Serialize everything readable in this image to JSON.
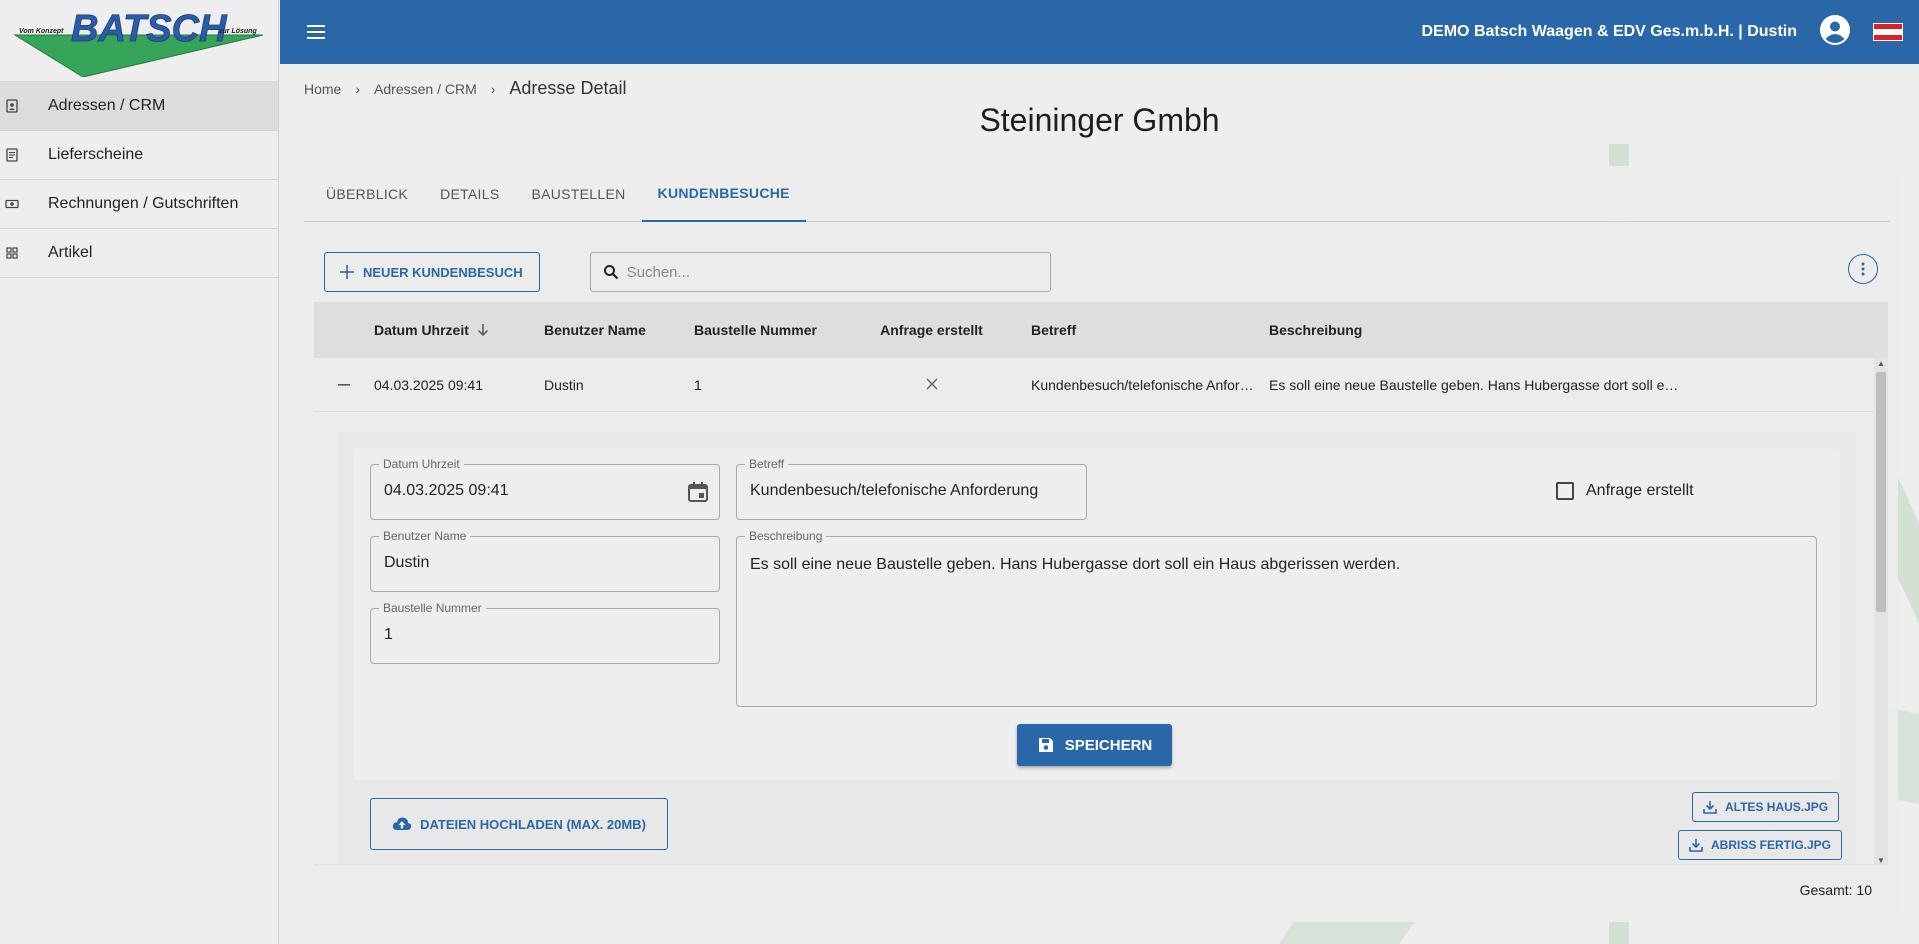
{
  "sidebar": {
    "logo": {
      "name": "BATSCH",
      "left_tag": "Vom Konzept",
      "right_tag": "zur Lösung"
    },
    "items": [
      {
        "label": "Adressen / CRM",
        "icon": "address-book-icon",
        "active": true
      },
      {
        "label": "Lieferscheine",
        "icon": "document-icon",
        "active": false
      },
      {
        "label": "Rechnungen / Gutschriften",
        "icon": "money-icon",
        "active": false
      },
      {
        "label": "Artikel",
        "icon": "grid-icon",
        "active": false
      }
    ]
  },
  "topbar": {
    "company": "DEMO Batsch Waagen & EDV Ges.m.b.H. | Dustin",
    "color": "#2a67a8"
  },
  "breadcrumb": {
    "home": "Home",
    "section": "Adressen / CRM",
    "current": "Adresse Detail"
  },
  "page_title": "Steininger Gmbh",
  "tabs": [
    {
      "label": "ÜBERBLICK",
      "active": false
    },
    {
      "label": "DETAILS",
      "active": false
    },
    {
      "label": "BAUSTELLEN",
      "active": false
    },
    {
      "label": "KUNDENBESUCHE",
      "active": true
    }
  ],
  "toolbar": {
    "new_label": "NEUER KUNDENBESUCH",
    "search_placeholder": "Suchen..."
  },
  "table": {
    "columns": [
      "Datum Uhrzeit",
      "Benutzer Name",
      "Baustelle Nummer",
      "Anfrage erstellt",
      "Betreff",
      "Beschreibung"
    ],
    "rows": [
      {
        "datum": "04.03.2025 09:41",
        "benutzer": "Dustin",
        "baustelle": "1",
        "anfrage": false,
        "betreff": "Kundenbesuch/telefonische Anforderung",
        "beschreibung": "Es soll eine neue Baustelle geben. Hans Hubergasse dort soll ein Haus abgerissen werden."
      }
    ]
  },
  "detail": {
    "datum_label": "Datum Uhrzeit",
    "datum_value": "04.03.2025 09:41",
    "betreff_label": "Betreff",
    "betreff_value": "Kundenbesuch/telefonische Anforderung",
    "anfrage_label": "Anfrage erstellt",
    "benutzer_label": "Benutzer Name",
    "benutzer_value": "Dustin",
    "baustelle_label": "Baustelle Nummer",
    "baustelle_value": "1",
    "beschreibung_label": "Beschreibung",
    "beschreibung_value": "Es soll eine neue Baustelle geben. Hans Hubergasse dort soll ein Haus abgerissen werden.",
    "save_label": "SPEICHERN",
    "upload_label": "DATEIEN HOCHLADEN (MAX. 20MB)",
    "files": [
      "ALTES HAUS.JPG",
      "ABRISS FERTIG.JPG"
    ]
  },
  "footer": {
    "total": "Gesamt: 10"
  }
}
